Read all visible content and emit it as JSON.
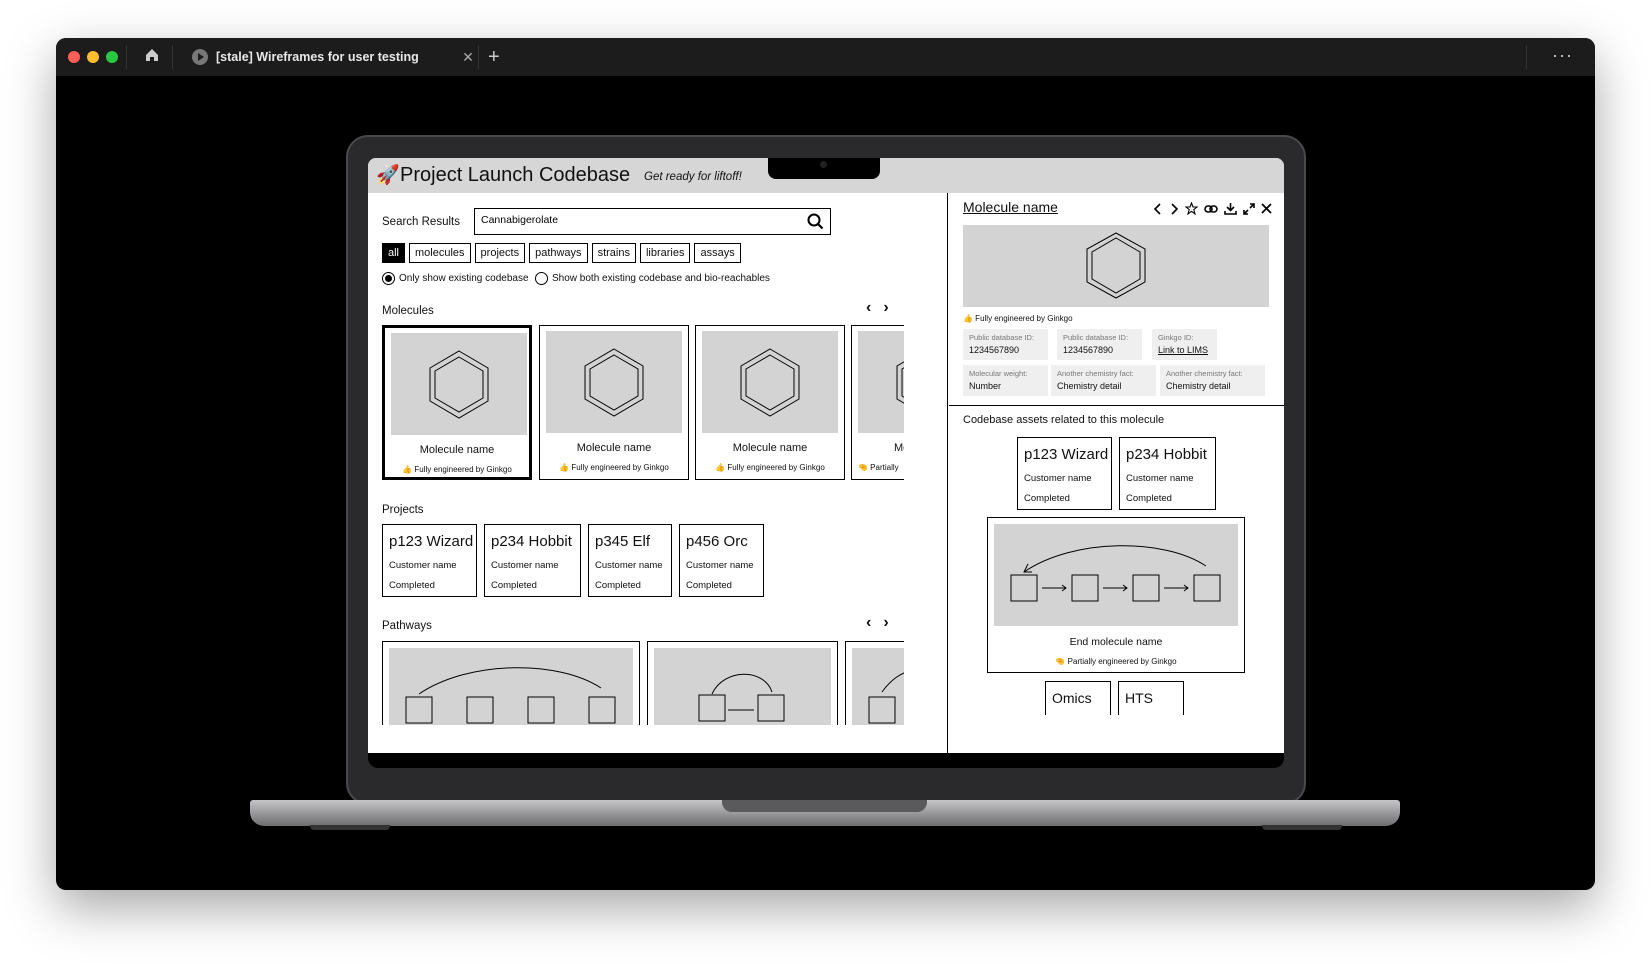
{
  "browser": {
    "tab_title": "[stale] Wireframes for user testing",
    "close_symbol": "✕",
    "new_tab_symbol": "+",
    "more_symbol": "···",
    "traffic_lights": [
      "#ff5f57",
      "#febc2e",
      "#28c840"
    ]
  },
  "app": {
    "title": "Project Launch Codebase",
    "subtitle": "Get ready for liftoff!",
    "logo_icon": "🚀"
  },
  "search": {
    "label": "Search Results",
    "query": "Cannabigerolate",
    "filters": [
      "all",
      "molecules",
      "projects",
      "pathways",
      "strains",
      "libraries",
      "assays"
    ],
    "active_filter": "all",
    "radio_existing": "Only show existing codebase",
    "radio_both": "Show both existing codebase and bio-reachables"
  },
  "molecules": {
    "title": "Molecules",
    "cards": [
      {
        "name": "Molecule name",
        "badge": "👍 Fully engineered by Ginkgo"
      },
      {
        "name": "Molecule name",
        "badge": "👍 Fully engineered by Ginkgo"
      },
      {
        "name": "Molecule name",
        "badge": "👍 Fully engineered by Ginkgo"
      },
      {
        "name": "Mol",
        "badge": "🤏 Partially"
      }
    ]
  },
  "projects": {
    "title": "Projects",
    "cards": [
      {
        "name": "p123 Wizard",
        "customer": "Customer name",
        "status": "Completed"
      },
      {
        "name": "p234 Hobbit",
        "customer": "Customer name",
        "status": "Completed"
      },
      {
        "name": "p345 Elf",
        "customer": "Customer name",
        "status": "Completed"
      },
      {
        "name": "p456 Orc",
        "customer": "Customer name",
        "status": "Completed"
      }
    ]
  },
  "pathways": {
    "title": "Pathways"
  },
  "detail": {
    "title": "Molecule name",
    "badge": "👍 Fully engineered by Ginkgo",
    "facts": [
      {
        "label": "Public database ID:",
        "value": "1234567890"
      },
      {
        "label": "Public database ID:",
        "value": "1234567890"
      },
      {
        "label": "Ginkgo ID:",
        "value": "Link to LIMS"
      },
      {
        "label": "Molecular weight:",
        "value": "Number"
      },
      {
        "label": "Another chemistry fact:",
        "value": "Chemistry detail"
      },
      {
        "label": "Another chemistry fact:",
        "value": "Chemistry detail"
      }
    ],
    "assets_title": "Codebase assets related to this molecule",
    "asset_projects": [
      {
        "name": "p123 Wizard",
        "customer": "Customer name",
        "status": "Completed"
      },
      {
        "name": "p234 Hobbit",
        "customer": "Customer name",
        "status": "Completed"
      }
    ],
    "end_molecule": "End molecule name",
    "end_badge": "🤏 Partially engineered by Ginkgo",
    "assays": [
      "Omics",
      "HTS"
    ]
  }
}
